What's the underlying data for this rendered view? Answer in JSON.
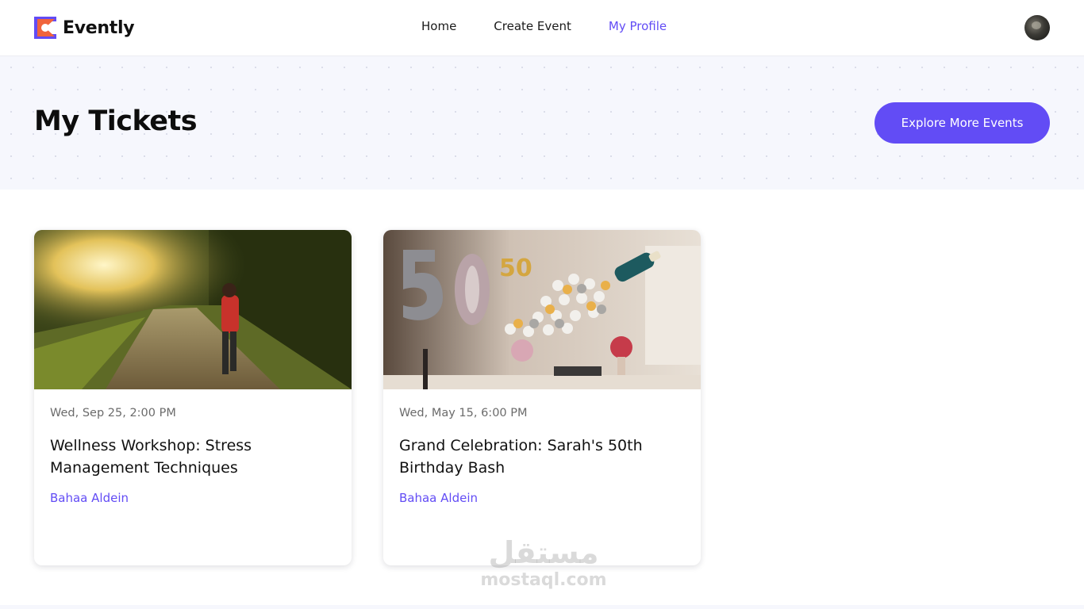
{
  "brand": {
    "name": "Evently",
    "accent": "#624cf5"
  },
  "nav": {
    "items": [
      {
        "label": "Home",
        "active": false
      },
      {
        "label": "Create Event",
        "active": false
      },
      {
        "label": "My Profile",
        "active": true
      }
    ]
  },
  "user": {
    "avatar_icon": "user-avatar"
  },
  "hero": {
    "title": "My Tickets",
    "explore_label": "Explore More Events"
  },
  "tickets": [
    {
      "date": "Wed, Sep 25, 2:00 PM",
      "title": "Wellness Workshop: Stress Management Techniques",
      "organizer": "Bahaa Aldein"
    },
    {
      "date": "Wed, May 15, 6:00 PM",
      "title": "Grand Celebration: Sarah's 50th Birthday Bash",
      "organizer": "Bahaa Aldein"
    }
  ],
  "watermark": {
    "arabic": "مستقل",
    "latin": "mostaql.com"
  }
}
